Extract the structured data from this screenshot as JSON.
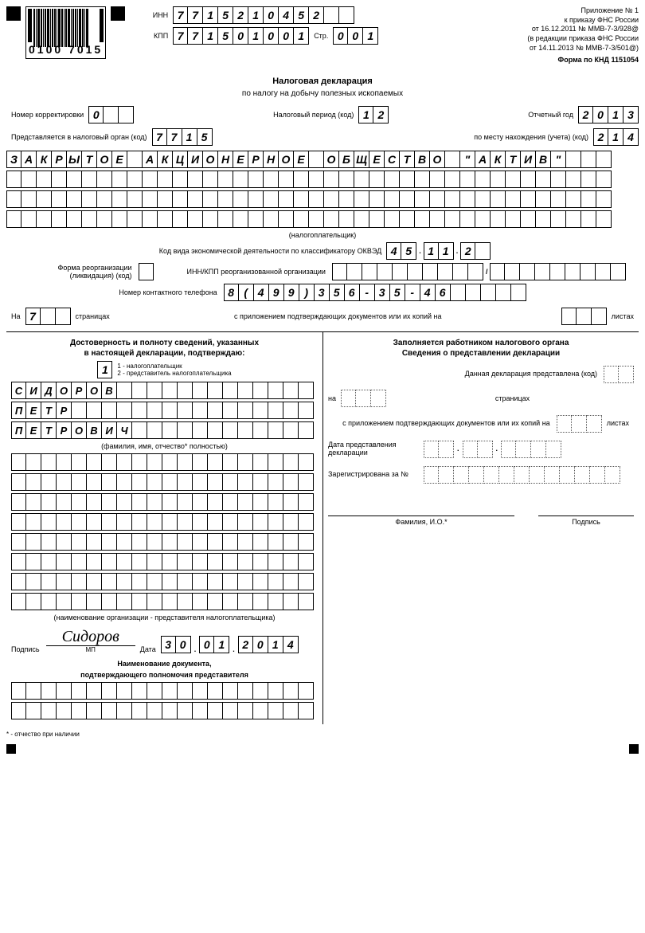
{
  "barcode_number": "0100 7015",
  "inn_label": "ИНН",
  "inn": "7715210452",
  "kpp_label": "КПП",
  "kpp": "771501001",
  "page_label": "Стр.",
  "page": "001",
  "header_right": {
    "l1": "Приложение № 1",
    "l2": "к приказу ФНС России",
    "l3": "от 16.12.2011 № ММВ-7-3/928@",
    "l4": "(в редакции приказа ФНС России",
    "l5": "от 14.11.2013 № ММВ-7-3/501@)"
  },
  "form_code_label": "Форма по КНД 1151054",
  "title": "Налоговая декларация",
  "subtitle": "по налогу на добычу полезных ископаемых",
  "corr_label": "Номер корректировки",
  "corr": "0",
  "period_label": "Налоговый период (код)",
  "period": "12",
  "year_label": "Отчетный год",
  "year": "2013",
  "organ_label": "Представляется в налоговый орган (код)",
  "organ": "7715",
  "place_label": "по месту нахождения (учета) (код)",
  "place": "214",
  "org_name_row1": "ЗАКРЫТОЕ АКЦИОНЕРНОЕ ОБЩЕСТВО \"АКТИВ\"",
  "taxpayer_hint": "(налогоплательщик)",
  "okved_label": "Код вида экономической деятельности по классификатору ОКВЭД",
  "okved_1": "45",
  "okved_2": "11",
  "okved_3": "2",
  "reorg_label": "Форма реорганизации (ликвидация) (код)",
  "innkpp_reorg_label": "ИНН/КПП реорганизованной организации",
  "phone_label": "Номер контактного телефона",
  "phone": "8(499)356-35-46",
  "pages_prefix": "На",
  "pages_count": "7",
  "pages_word": "страницах",
  "attach_label": "с приложением подтверждающих документов или их копий на",
  "sheets_word": "листах",
  "left": {
    "title1": "Достоверность и полноту сведений, указанных",
    "title2": "в настоящей декларации, подтверждаю:",
    "who": "1",
    "opt1": "1 - налогоплательщик",
    "opt2": "2 - представитель налогоплательщика",
    "surname": "СИДОРОВ",
    "name": "ПЕТР",
    "patronymic": "ПЕТРОВИЧ",
    "fio_hint": "(фамилия, имя, отчество* полностью)",
    "org_rep_hint": "(наименование организации - представителя налогоплательщика)",
    "sign_label": "Подпись",
    "signature": "Сидоров",
    "mp": "МП",
    "date_label": "Дата",
    "date_d": "30",
    "date_m": "01",
    "date_y": "2014",
    "doc_auth_title1": "Наименование документа,",
    "doc_auth_title2": "подтверждающего полномочия представителя"
  },
  "right": {
    "title1": "Заполняется работником налогового органа",
    "title2": "Сведения о представлении декларации",
    "pres_code_label": "Данная декларация представлена (код)",
    "na_label": "на",
    "pages_word": "страницах",
    "attach_label": "с приложением подтверждающих документов или их копий на",
    "sheets_word": "листах",
    "date_label": "Дата представления декларации",
    "reg_label": "Зарегистрирована за №",
    "fio_label": "Фамилия, И.О.*",
    "sign_label": "Подпись"
  },
  "footnote": "* - отчество при наличии"
}
